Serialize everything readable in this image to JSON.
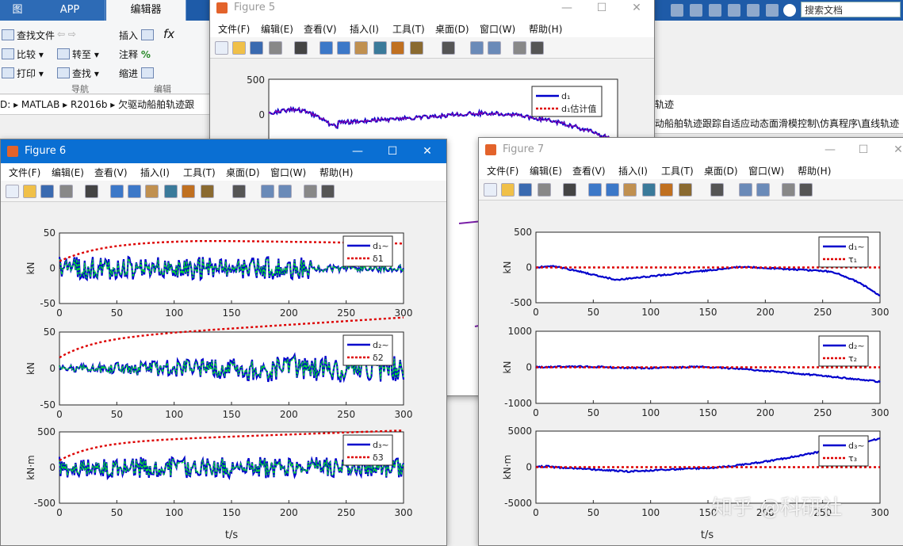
{
  "desktop": {
    "tabs": [
      "图",
      "APP",
      "编辑器"
    ],
    "ribbon": {
      "row1": [
        "查找文件",
        "插入",
        "fx"
      ],
      "row2": [
        "比较",
        "转至",
        "注释",
        "%"
      ],
      "row3": [
        "打印",
        "查找",
        "缩进"
      ],
      "sections": [
        "导航",
        "编辑"
      ]
    },
    "search_placeholder": "搜索文档",
    "address": "D: ▸ MATLAB ▸ R2016b ▸ 欠驱动船舶轨迹跟",
    "address_tail": "轨迹",
    "address_right": "动船舶轨迹跟踪自适应动态面滑模控制\\仿真程序\\直线轨迹"
  },
  "menus": [
    "文件(F)",
    "编辑(E)",
    "查看(V)",
    "插入(I)",
    "工具(T)",
    "桌面(D)",
    "窗口(W)",
    "帮助(H)"
  ],
  "win_buttons": {
    "min": "—",
    "max": "☐",
    "close": "✕"
  },
  "figures": {
    "fig5": {
      "title": "Figure 5",
      "plot": {
        "ylabel": "kN",
        "yticks": [
          "500",
          "0"
        ],
        "legend": [
          "d₁",
          "d₁估计值"
        ]
      }
    },
    "fig6": {
      "title": "Figure 6",
      "xlabel": "t/s",
      "xticks": [
        "0",
        "50",
        "100",
        "150",
        "200",
        "250",
        "300"
      ],
      "plots": [
        {
          "ylabel": "kN",
          "yticks": [
            "50",
            "0",
            "-50"
          ],
          "legend": [
            "d₁~",
            "δ1"
          ]
        },
        {
          "ylabel": "kN",
          "yticks": [
            "50",
            "0",
            "-50"
          ],
          "legend": [
            "d₂~",
            "δ2"
          ]
        },
        {
          "ylabel": "kN·m",
          "yticks": [
            "500",
            "0",
            "-500"
          ],
          "legend": [
            "d₃~",
            "δ3"
          ]
        }
      ]
    },
    "fig7": {
      "title": "Figure 7",
      "xlabel": "t/s",
      "xticks": [
        "0",
        "50",
        "100",
        "150",
        "200",
        "250",
        "300"
      ],
      "plots": [
        {
          "ylabel": "kN",
          "yticks": [
            "500",
            "0",
            "-500"
          ],
          "legend": [
            "d₁~",
            "τ₁"
          ]
        },
        {
          "ylabel": "kN",
          "yticks": [
            "1000",
            "0",
            "-1000"
          ],
          "legend": [
            "d₂~",
            "τ₂"
          ]
        },
        {
          "ylabel": "kN·m",
          "yticks": [
            "5000",
            "0",
            "-5000"
          ],
          "legend": [
            "d₃~",
            "τ₃"
          ]
        }
      ]
    }
  },
  "watermark": "知乎 @科研社",
  "colors": {
    "accent": "#0a6fd3",
    "series_blue": "#0000cc",
    "series_green": "#00e030",
    "series_red": "#dd0000",
    "matlab_blue": "#1e5ba8"
  }
}
